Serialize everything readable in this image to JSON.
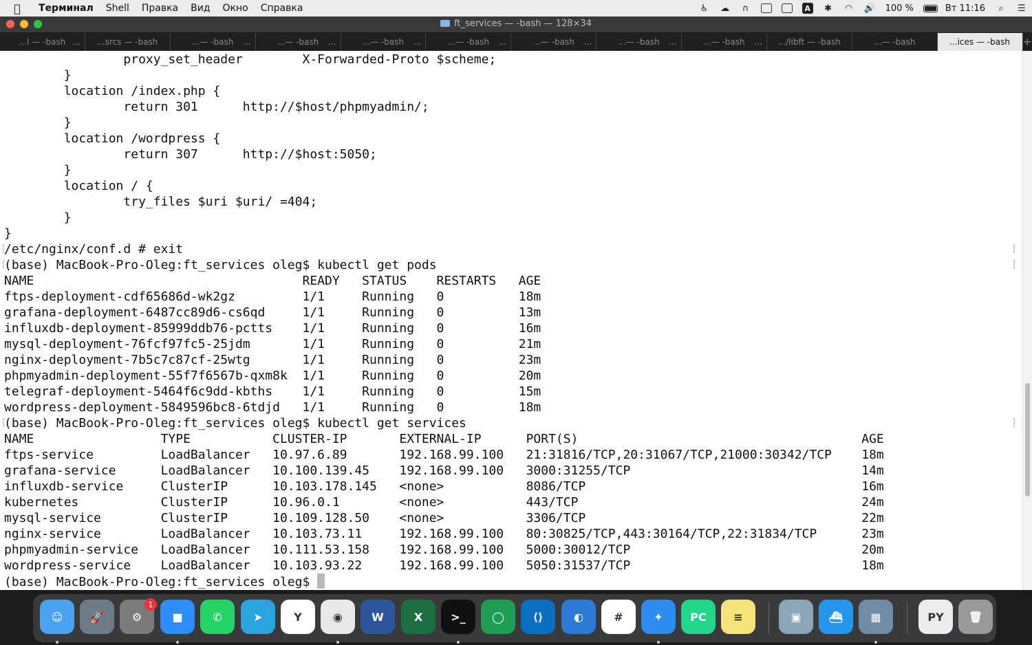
{
  "menubar": {
    "app_name": "Терминал",
    "items": [
      "Shell",
      "Правка",
      "Вид",
      "Окно",
      "Справка"
    ],
    "battery": "100 %",
    "clock": "Вт 11:16",
    "keyboard_layout": "A"
  },
  "window": {
    "title": "ft_services — -bash — 128×34",
    "tabs": [
      {
        "label": "...l — -bash"
      },
      {
        "label": "...srcs — -bash"
      },
      {
        "label": "...— -bash"
      },
      {
        "label": "...— -bash"
      },
      {
        "label": "...— -bash"
      },
      {
        "label": "...— -bash"
      },
      {
        "label": "...— -bash"
      },
      {
        "label": "...— -bash"
      },
      {
        "label": "...— -bash"
      },
      {
        "label": ".../libft — -bash"
      },
      {
        "label": "...— -bash"
      },
      {
        "label": "...ices — -bash",
        "active": true
      }
    ],
    "tab_more": "...",
    "tab_add": "+"
  },
  "terminal": {
    "lines": [
      "                proxy_set_header        X-Forwarded-Proto $scheme;",
      "        }",
      "        location /index.php {",
      "                return 301      http://$host/phpmyadmin/;",
      "        }",
      "        location /wordpress {",
      "                return 307      http://$host:5050;",
      "        }",
      "        location / {",
      "                try_files $uri $uri/ =404;",
      "        }",
      "}",
      "/etc/nginx/conf.d # exit",
      "(base) MacBook-Pro-Oleg:ft_services oleg$ kubectl get pods",
      "NAME                                    READY   STATUS    RESTARTS   AGE",
      "ftps-deployment-cdf65686d-wk2gz         1/1     Running   0          18m",
      "grafana-deployment-6487cc89d6-cs6qd     1/1     Running   0          13m",
      "influxdb-deployment-85999ddb76-pctts    1/1     Running   0          16m",
      "mysql-deployment-76fcf97fc5-25jdm       1/1     Running   0          21m",
      "nginx-deployment-7b5c7c87cf-25wtg       1/1     Running   0          23m",
      "phpmyadmin-deployment-55f7f6567b-qxm8k  1/1     Running   0          20m",
      "telegraf-deployment-5464f6c9dd-kbths    1/1     Running   0          15m",
      "wordpress-deployment-5849596bc8-6tdjd   1/1     Running   0          18m",
      "(base) MacBook-Pro-Oleg:ft_services oleg$ kubectl get services",
      "NAME                 TYPE           CLUSTER-IP       EXTERNAL-IP      PORT(S)                                      AGE",
      "ftps-service         LoadBalancer   10.97.6.89       192.168.99.100   21:31816/TCP,20:31067/TCP,21000:30342/TCP    18m",
      "grafana-service      LoadBalancer   10.100.139.45    192.168.99.100   3000:31255/TCP                               14m",
      "influxdb-service     ClusterIP      10.103.178.145   <none>           8086/TCP                                     16m",
      "kubernetes           ClusterIP      10.96.0.1        <none>           443/TCP                                      24m",
      "mysql-service        ClusterIP      10.109.128.50    <none>           3306/TCP                                     22m",
      "nginx-service        LoadBalancer   10.103.73.11     192.168.99.100   80:30825/TCP,443:30164/TCP,22:31834/TCP      23m",
      "phpmyadmin-service   LoadBalancer   10.111.53.158    192.168.99.100   5000:30012/TCP                               20m",
      "wordpress-service    LoadBalancer   10.103.93.22     192.168.99.100   5050:31537/TCP                               18m",
      "(base) MacBook-Pro-Oleg:ft_services oleg$ "
    ],
    "scroll_position_fraction": 0.78
  },
  "dock": {
    "apps": [
      {
        "name": "finder-icon",
        "glyph": "☺",
        "color": "#4aa3f0",
        "running": true
      },
      {
        "name": "launchpad-icon",
        "glyph": "🚀",
        "color": "#6e7a86",
        "running": false
      },
      {
        "name": "system-preferences-icon",
        "glyph": "⚙",
        "color": "#7b7b7b",
        "running": false,
        "badge": "1"
      },
      {
        "name": "zoom-icon",
        "glyph": "■",
        "color": "#2d8cff",
        "running": true
      },
      {
        "name": "whatsapp-icon",
        "glyph": "✆",
        "color": "#25d366",
        "running": false
      },
      {
        "name": "telegram-icon",
        "glyph": "➤",
        "color": "#2aa3de",
        "running": false
      },
      {
        "name": "yandex-browser-icon",
        "glyph": "Y",
        "color": "#ffffff",
        "running": false
      },
      {
        "name": "chrome-icon",
        "glyph": "◉",
        "color": "#e8e8e8",
        "running": true
      },
      {
        "name": "word-icon",
        "glyph": "W",
        "color": "#2b579a",
        "running": false
      },
      {
        "name": "excel-icon",
        "glyph": "X",
        "color": "#1d6f42",
        "running": false
      },
      {
        "name": "terminal-icon",
        "glyph": ">_",
        "color": "#111111",
        "running": true
      },
      {
        "name": "minikube-icon",
        "glyph": "◯",
        "color": "#1f9d55",
        "running": false
      },
      {
        "name": "vscode-icon",
        "glyph": "⟨⟩",
        "color": "#0a6fc2",
        "running": false
      },
      {
        "name": "tor-browser-icon",
        "glyph": "◐",
        "color": "#2b7bd6",
        "running": false
      },
      {
        "name": "slack-icon",
        "glyph": "#",
        "color": "#ffffff",
        "running": false
      },
      {
        "name": "safari-icon",
        "glyph": "✦",
        "color": "#2d8cf0",
        "running": true
      },
      {
        "name": "pycharm-icon",
        "glyph": "PC",
        "color": "#21d789",
        "running": false
      },
      {
        "name": "notes-icon",
        "glyph": "≡",
        "color": "#f7e27a",
        "running": false
      },
      {
        "name": "preview-icon",
        "glyph": "▣",
        "color": "#8aa6b8",
        "running": false
      },
      {
        "name": "docker-icon",
        "glyph": "⛴",
        "color": "#2496ed",
        "running": false
      },
      {
        "name": "virtualbox-icon",
        "glyph": "▦",
        "color": "#6f8ba6",
        "running": true
      },
      {
        "name": "python-document-icon",
        "glyph": "PY",
        "color": "#ececec",
        "running": false
      },
      {
        "name": "trash-icon",
        "glyph": "🗑",
        "color": "#9a9a9a",
        "running": false
      }
    ]
  }
}
